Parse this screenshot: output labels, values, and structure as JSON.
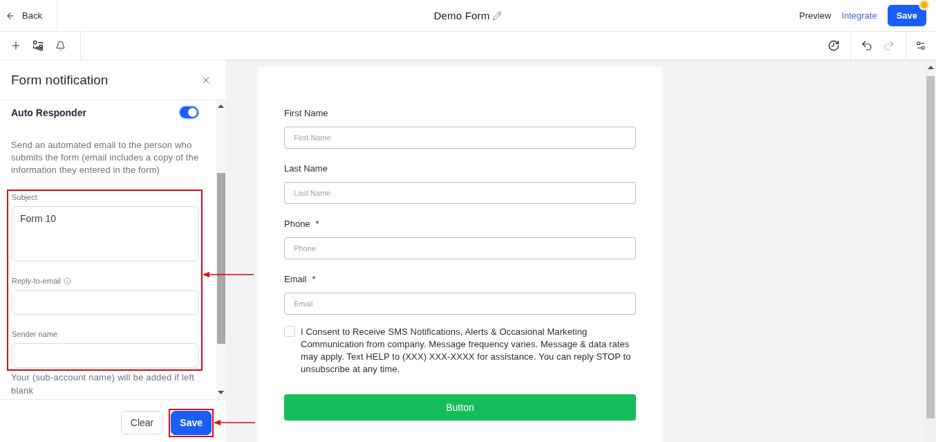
{
  "top_bar": {
    "back": "Back",
    "title": "Demo Form",
    "links": [
      {
        "label": "Preview",
        "kind": "plain"
      },
      {
        "label": "Integrate",
        "kind": "accent"
      }
    ],
    "save": {
      "label": "Save",
      "badge": true
    }
  },
  "toolbar": {
    "history_actions": [
      {
        "kind": "undo",
        "disabled": false
      },
      {
        "kind": "redo",
        "disabled": true
      }
    ]
  },
  "notification_panel": {
    "title": "Form notification",
    "section": {
      "label": "Auto Responder",
      "on": true
    },
    "description": "Send an automated email to the person who submits the form (email includes a copy of the information they entered in the form)",
    "highlighted": true,
    "fields": [
      {
        "kind": "textarea",
        "label": "Subject",
        "info": false,
        "value": "Form 10"
      },
      {
        "kind": "input",
        "label": "Reply-to-email",
        "info": true
      },
      {
        "kind": "input",
        "label": "Sender name",
        "info": false
      }
    ],
    "helper": "Your (sub-account name) will be added if left blank",
    "buttons": [
      {
        "label": "Clear",
        "kind": "secondary",
        "highlighted": false
      },
      {
        "label": "Save",
        "kind": "primary",
        "highlighted": true
      }
    ]
  },
  "form": {
    "fields": [
      {
        "label": "First Name",
        "placeholder": "First Name"
      },
      {
        "label": "Last Name",
        "placeholder": "Last Name"
      },
      {
        "label": "Phone",
        "required_mark": "*",
        "placeholder": "Phone"
      },
      {
        "label": "Email",
        "required_mark": "*",
        "placeholder": "Email"
      }
    ],
    "consent": {
      "text": "I Consent to Receive SMS Notifications, Alerts & Occasional Marketing Communication from company. Message frequency varies. Message & data rates may apply. Text HELP to (XXX) XXX-XXXX for assistance. You can reply STOP to unsubscribe at any time.",
      "checked": false
    },
    "button": "Button"
  }
}
